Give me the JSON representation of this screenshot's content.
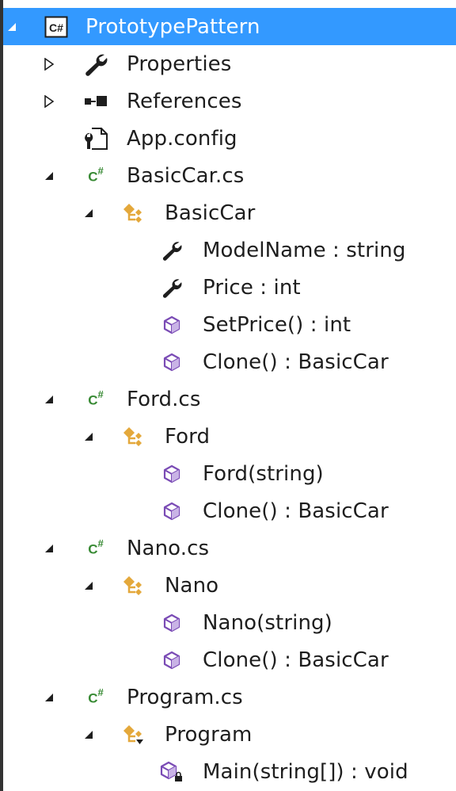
{
  "colors": {
    "selection": "#3399ff",
    "cs_green": "#388a34",
    "class_orange": "#e4a83b",
    "method_purple": "#7a4bb5"
  },
  "tree": [
    {
      "label": "PrototypePattern",
      "icon": "csharp-project-icon",
      "expander": "expanded",
      "selected": true
    },
    {
      "label": "Properties",
      "icon": "wrench-icon",
      "expander": "collapsed"
    },
    {
      "label": "References",
      "icon": "references-icon",
      "expander": "collapsed"
    },
    {
      "label": "App.config",
      "icon": "config-file-icon",
      "expander": "none"
    },
    {
      "label": "BasicCar.cs",
      "icon": "csharp-file-icon",
      "expander": "expanded"
    },
    {
      "label": "BasicCar",
      "icon": "class-icon",
      "expander": "expanded"
    },
    {
      "label": "ModelName : string",
      "icon": "property-wrench-icon",
      "expander": "none"
    },
    {
      "label": "Price : int",
      "icon": "property-wrench-icon",
      "expander": "none"
    },
    {
      "label": "SetPrice() : int",
      "icon": "method-icon",
      "expander": "none"
    },
    {
      "label": "Clone() : BasicCar",
      "icon": "method-icon",
      "expander": "none"
    },
    {
      "label": "Ford.cs",
      "icon": "csharp-file-icon",
      "expander": "expanded"
    },
    {
      "label": "Ford",
      "icon": "class-icon",
      "expander": "expanded"
    },
    {
      "label": "Ford(string)",
      "icon": "method-icon",
      "expander": "none"
    },
    {
      "label": "Clone() : BasicCar",
      "icon": "method-icon",
      "expander": "none"
    },
    {
      "label": "Nano.cs",
      "icon": "csharp-file-icon",
      "expander": "expanded"
    },
    {
      "label": "Nano",
      "icon": "class-icon",
      "expander": "expanded"
    },
    {
      "label": "Nano(string)",
      "icon": "method-icon",
      "expander": "none"
    },
    {
      "label": "Clone() : BasicCar",
      "icon": "method-icon",
      "expander": "none"
    },
    {
      "label": "Program.cs",
      "icon": "csharp-file-icon",
      "expander": "expanded"
    },
    {
      "label": "Program",
      "icon": "internal-class-icon",
      "expander": "expanded"
    },
    {
      "label": "Main(string[]) : void",
      "icon": "private-method-icon",
      "expander": "none"
    }
  ]
}
